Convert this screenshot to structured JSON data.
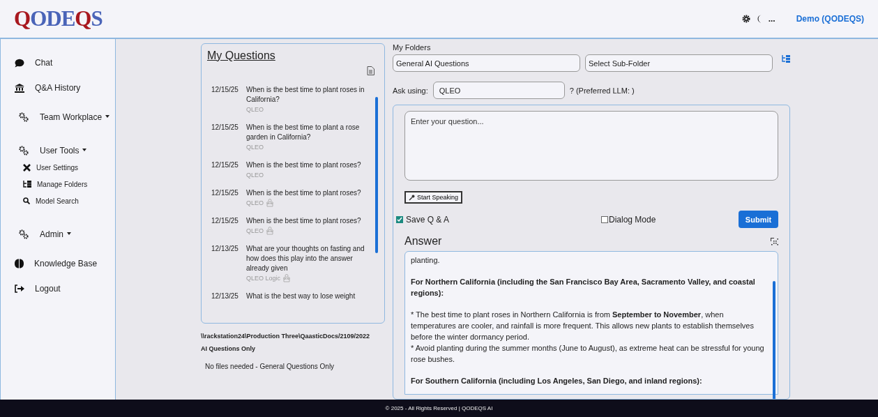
{
  "header": {
    "logo": [
      {
        "text": "Q",
        "color": "#a8181f"
      },
      {
        "text": "ODE",
        "color": "#4a64b8"
      },
      {
        "text": "Q",
        "color": "#a8181f"
      },
      {
        "text": "S",
        "color": "#4a64b8"
      }
    ],
    "more": "...",
    "user": "Demo (QODEQS)"
  },
  "sidebar": {
    "items": [
      {
        "kind": "item",
        "label": "Chat"
      },
      {
        "kind": "item",
        "label": "Q&A History"
      },
      {
        "kind": "group",
        "label": "Team Workplace"
      },
      {
        "kind": "group",
        "label": "User Tools",
        "children": [
          {
            "label": "User Settings"
          },
          {
            "label": "Manage Folders"
          },
          {
            "label": "Model Search"
          }
        ]
      },
      {
        "kind": "group",
        "label": "Admin"
      },
      {
        "kind": "item",
        "label": "Knowledge Base"
      },
      {
        "kind": "item",
        "label": "Logout"
      }
    ]
  },
  "questions": {
    "title": "My Questions",
    "items": [
      {
        "date": "12/15/25",
        "text": "When is the best time to plant roses in California?",
        "model": "QLEO",
        "shared": false
      },
      {
        "date": "12/15/25",
        "text": "When is the best time to plant a rose garden in California?",
        "model": "QLEO",
        "shared": false
      },
      {
        "date": "12/15/25",
        "text": "When is the best time to plant roses?",
        "model": "QLEO",
        "shared": false
      },
      {
        "date": "12/15/25",
        "text": "When is the best time to plant roses?",
        "model": "QLEO",
        "shared": true
      },
      {
        "date": "12/15/25",
        "text": "When is the best time to plant roses?",
        "model": "QLEO",
        "shared": true
      },
      {
        "date": "12/13/25",
        "text": "What are your thoughts on fasting and how does this play into the answer already given",
        "model": "QLEO Logic",
        "shared": true
      },
      {
        "date": "12/13/25",
        "text": "What is the best way to lose weight"
      }
    ],
    "path": "\\\\rackstation24\\Production Three\\QaasticDocs/2109/2022",
    "folder_note": "AI Questions Only",
    "files_note": "No files needed - General Questions Only"
  },
  "ask": {
    "folders_label": "My Folders",
    "folder": "General AI Questions",
    "subfolder_placeholder": "Select Sub-Folder",
    "ask_label": "Ask using:",
    "model": "QLEO",
    "preferred": "? (Preferred LLM: )",
    "question_placeholder": "Enter your question...",
    "speak_button": "Start Speaking",
    "save_qa": {
      "label": "Save Q & A",
      "checked": true
    },
    "dialog_mode": {
      "label": "Dialog Mode",
      "checked": false
    },
    "submit": "Submit"
  },
  "answer": {
    "title": "Answer",
    "paragraphs": [
      "planting.",
      "**For Northern California (including the San Francisco Bay Area, Sacramento Valley, and coastal regions):**",
      "* The best time to plant roses in Northern California is from **September to November**, when temperatures are cooler, and rainfall is more frequent. This allows new plants to establish themselves before the winter dormancy period.\n* Avoid planting during the summer months (June to August), as extreme heat can be stressful for young rose bushes.",
      "**For Southern California (including Los Angeles, San Diego, and inland regions):**"
    ]
  },
  "footer": "© 2025 - All Rights Reserved | QODEQS AI"
}
